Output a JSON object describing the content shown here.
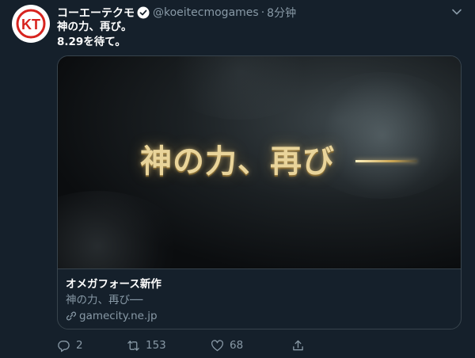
{
  "tweet": {
    "display_name": "コーエーテクモ",
    "handle": "@koeitecmogames",
    "separator": "·",
    "time": "8分钟",
    "line1": "神の力、再び。",
    "line2": "8.29を待て。",
    "avatar_logo": "KT"
  },
  "card": {
    "media_title": "神の力、再び",
    "title": "オメガフォース新作",
    "description": "神の力、再び──",
    "domain": "gamecity.ne.jp"
  },
  "actions": {
    "reply_count": "2",
    "retweet_count": "153",
    "like_count": "68"
  },
  "icons": {
    "verified": "verified-badge-icon",
    "more": "chevron-down-icon",
    "link": "link-icon",
    "reply": "reply-icon",
    "retweet": "retweet-icon",
    "like": "heart-icon",
    "share": "share-icon"
  },
  "colors": {
    "background": "#15202b",
    "secondary_text": "#8899a6",
    "border": "#38444d",
    "logo_red": "#d7231e"
  }
}
